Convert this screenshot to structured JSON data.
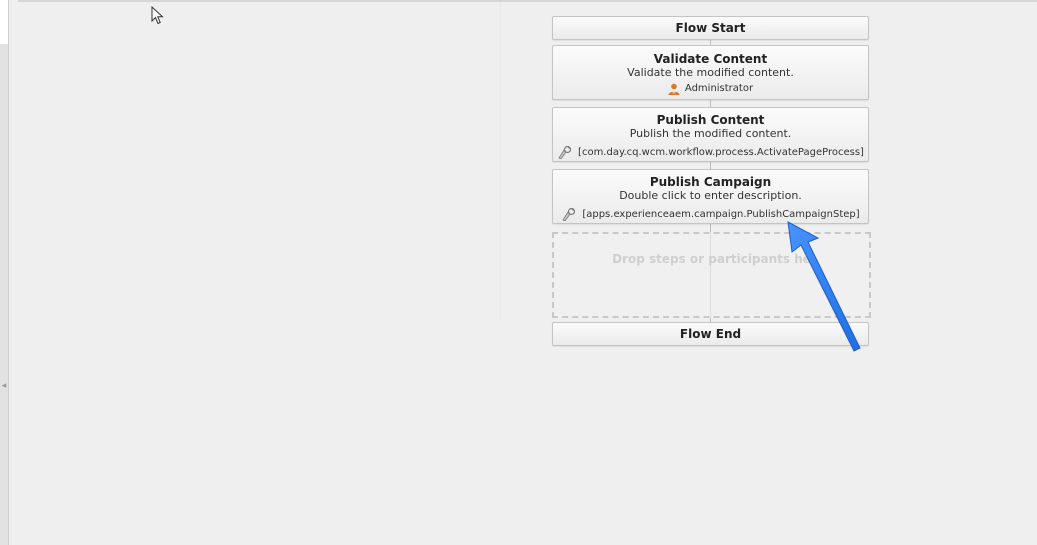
{
  "workflow": {
    "flow_start": "Flow Start",
    "flow_end": "Flow End",
    "drop_placeholder": "Drop steps or participants he",
    "steps": [
      {
        "title": "Validate Content",
        "description": "Validate the modified content.",
        "meta": "Administrator",
        "meta_icon": "user-icon"
      },
      {
        "title": "Publish Content",
        "description": "Publish the modified content.",
        "meta": "[com.day.cq.wcm.workflow.process.ActivatePageProcess]",
        "meta_icon": "process-icon"
      },
      {
        "title": "Publish Campaign",
        "description": "Double click to enter description.",
        "meta": "[apps.experienceaem.campaign.PublishCampaignStep]",
        "meta_icon": "process-icon"
      }
    ]
  },
  "colors": {
    "annotation_arrow": "#2f7ff0",
    "user_icon": "#d9792b"
  }
}
